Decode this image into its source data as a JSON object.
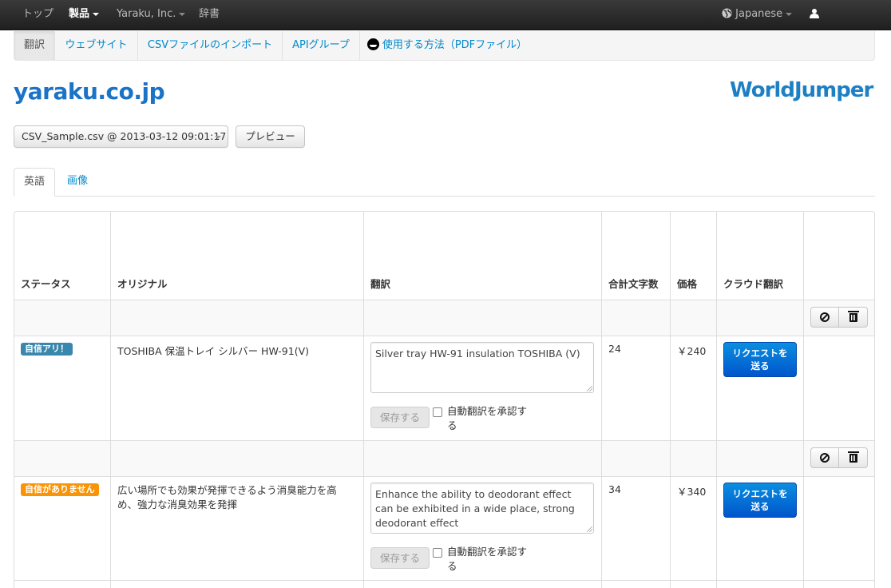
{
  "topbar": {
    "home": "トップ",
    "products": "製品",
    "company": "Yaraku, Inc.",
    "dictionary": "辞書",
    "language": "Japanese"
  },
  "subnav": {
    "tabs": [
      "翻訳",
      "ウェブサイト",
      "CSVファイルのインポート",
      "APIグループ",
      "使用する方法（PDFファイル）"
    ]
  },
  "site": {
    "title": "yaraku.co.jp",
    "brand": "WorldJumper"
  },
  "file": {
    "selected": "CSV_Sample.csv @ 2013-03-12 09:01:17",
    "preview_label": "プレビュー"
  },
  "lang_tabs": [
    "英語",
    "画像"
  ],
  "table": {
    "headers": [
      "ステータス",
      "オリジナル",
      "翻訳",
      "合計文字数",
      "価格",
      "クラウド翻訳"
    ],
    "rows": [
      {
        "status": "自信アリ！",
        "original": "TOSHIBA 保温トレイ シルバー HW-91(V)",
        "translation": "Silver tray HW-91 insulation TOSHIBA (V)",
        "chars": "24",
        "price": "￥240",
        "save": "保存する",
        "approve_line1": "自動翻訳を承認す",
        "approve_line2": "る",
        "request_line1": "リクエストを",
        "request_line2": "送る"
      },
      {
        "status": "自信がありません",
        "original_line1": "広い場所でも効果が発揮できるよう消臭能力を高",
        "original_line2": "め、強力な消臭効果を発揮",
        "translation": "Enhance the ability to deodorant effect can be exhibited in a wide place, strong deodorant effect",
        "chars": "34",
        "price": "￥340",
        "save": "保存する",
        "approve_line1": "自動翻訳を承認す",
        "approve_line2": "る",
        "request_line1": "リクエストを",
        "request_line2": "送る"
      }
    ]
  },
  "colors": {
    "link": "#0088cc",
    "title": "#1a73c7",
    "primary_button": "#0055cc",
    "badge_info": "#3a87ad",
    "badge_warning": "#f89406"
  }
}
